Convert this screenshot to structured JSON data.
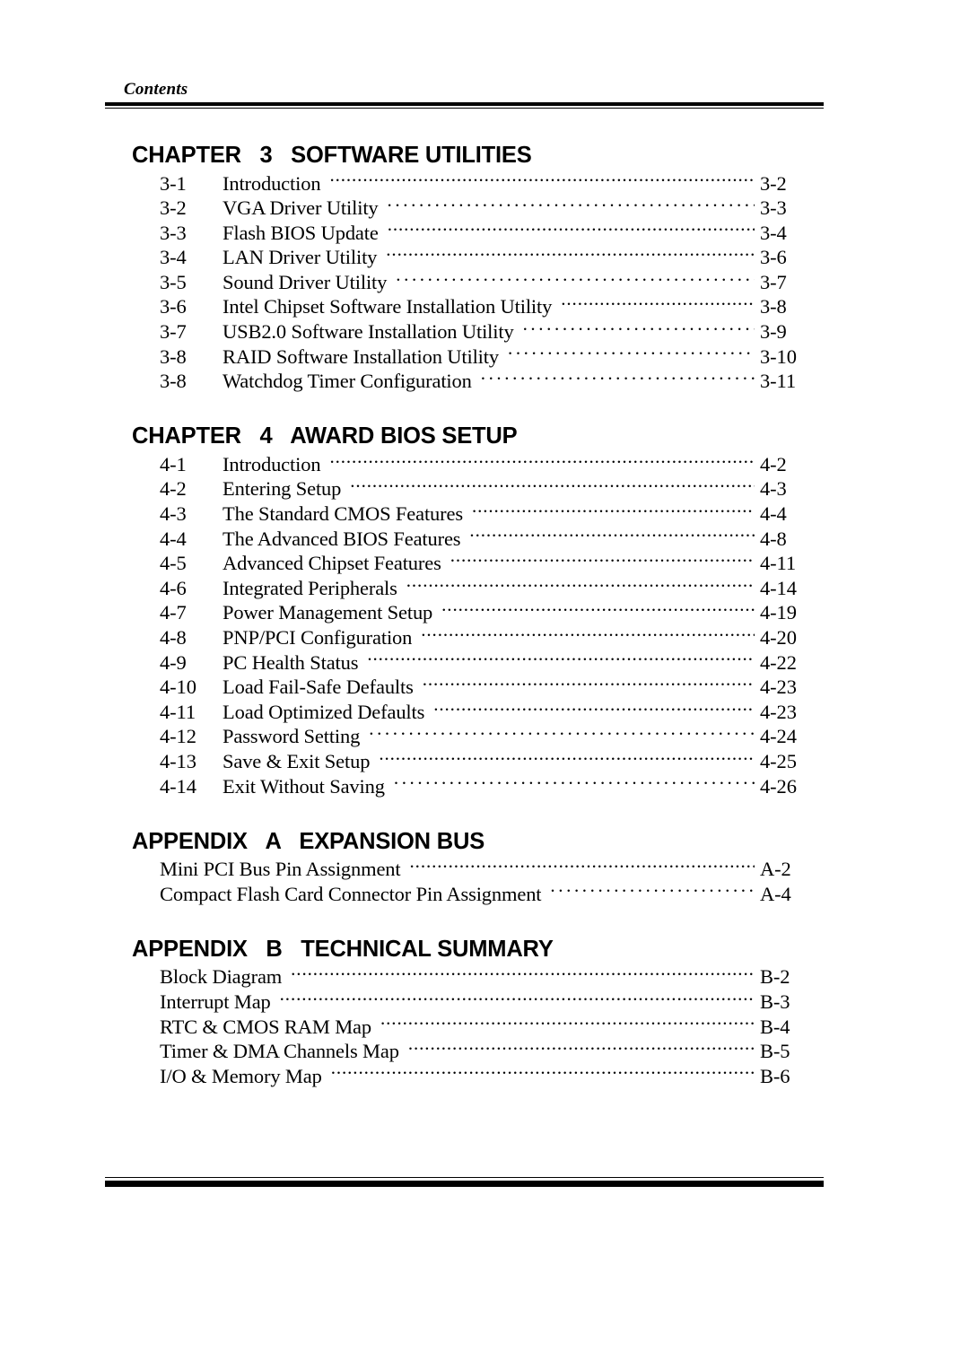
{
  "header": {
    "label": "Contents"
  },
  "sections": [
    {
      "heading": "CHAPTER   3   SOFTWARE UTILITIES",
      "entries": [
        {
          "num": "3-1",
          "title": "Introduction",
          "page": "3-2",
          "leader": "tight"
        },
        {
          "num": "3-2",
          "title": "VGA Driver Utility",
          "page": "3-3",
          "leader": "wide"
        },
        {
          "num": "3-3",
          "title": "Flash BIOS Update",
          "page": "3-4",
          "leader": "tight"
        },
        {
          "num": "3-4",
          "title": "LAN Driver Utility",
          "page": "3-6",
          "leader": "tight"
        },
        {
          "num": "3-5",
          "title": "Sound Driver Utility",
          "page": "3-7",
          "leader": "wide"
        },
        {
          "num": "3-6",
          "title": "Intel Chipset Software Installation Utility",
          "page": "3-8",
          "leader": "tight"
        },
        {
          "num": "3-7",
          "title": "USB2.0 Software Installation Utility",
          "page": "3-9",
          "leader": "wide"
        },
        {
          "num": "3-8",
          "title": "RAID Software Installation Utility",
          "page": "3-10",
          "leader": "wide"
        },
        {
          "num": "3-8",
          "title": "Watchdog Timer Configuration",
          "page": "3-11",
          "leader": "wide"
        }
      ]
    },
    {
      "heading": "CHAPTER   4   AWARD BIOS SETUP",
      "entries": [
        {
          "num": "4-1",
          "title": "Introduction",
          "page": "4-2",
          "leader": "tight"
        },
        {
          "num": "4-2",
          "title": "Entering Setup",
          "page": "4-3",
          "leader": "tight"
        },
        {
          "num": "4-3",
          "title": "The Standard CMOS Features",
          "page": "4-4",
          "leader": "tight"
        },
        {
          "num": "4-4",
          "title": "The Advanced BIOS Features",
          "page": "4-8",
          "leader": "tight"
        },
        {
          "num": "4-5",
          "title": "Advanced Chipset Features",
          "page": "4-11",
          "leader": "tight"
        },
        {
          "num": "4-6",
          "title": "Integrated Peripherals",
          "page": "4-14",
          "leader": "tight"
        },
        {
          "num": "4-7",
          "title": "Power Management Setup",
          "page": "4-19",
          "leader": "tight"
        },
        {
          "num": "4-8",
          "title": "PNP/PCI Configuration",
          "page": "4-20",
          "leader": "tight"
        },
        {
          "num": "4-9",
          "title": "PC Health Status",
          "page": "4-22",
          "leader": "tight"
        },
        {
          "num": "4-10",
          "title": "Load Fail-Safe Defaults",
          "page": "4-23",
          "leader": "tight"
        },
        {
          "num": "4-11",
          "title": "Load Optimized Defaults",
          "page": "4-23",
          "leader": "tight"
        },
        {
          "num": "4-12",
          "title": "Password Setting",
          "page": "4-24",
          "leader": "wide"
        },
        {
          "num": "4-13",
          "title": "Save & Exit Setup",
          "page": "4-25",
          "leader": "tight"
        },
        {
          "num": "4-14",
          "title": "Exit Without Saving",
          "page": "4-26",
          "leader": "wide"
        }
      ]
    },
    {
      "heading": "APPENDIX   A   EXPANSION BUS",
      "entries": [
        {
          "num": "",
          "title": "Mini PCI Bus Pin Assignment",
          "page": "A-2",
          "leader": "tight"
        },
        {
          "num": "",
          "title": "Compact Flash Card Connector Pin Assignment",
          "page": "A-4",
          "leader": "wide"
        }
      ]
    },
    {
      "heading": "APPENDIX   B   TECHNICAL SUMMARY",
      "entries": [
        {
          "num": "",
          "title": "Block Diagram",
          "page": "B-2",
          "leader": "tight"
        },
        {
          "num": "",
          "title": "Interrupt Map",
          "page": "B-3",
          "leader": "tight"
        },
        {
          "num": "",
          "title": "RTC & CMOS RAM Map",
          "page": "B-4",
          "leader": "tight"
        },
        {
          "num": "",
          "title": "Timer & DMA Channels Map",
          "page": "B-5",
          "leader": "tight"
        },
        {
          "num": "",
          "title": "I/O & Memory Map",
          "page": "B-6",
          "leader": "tight"
        }
      ]
    }
  ]
}
